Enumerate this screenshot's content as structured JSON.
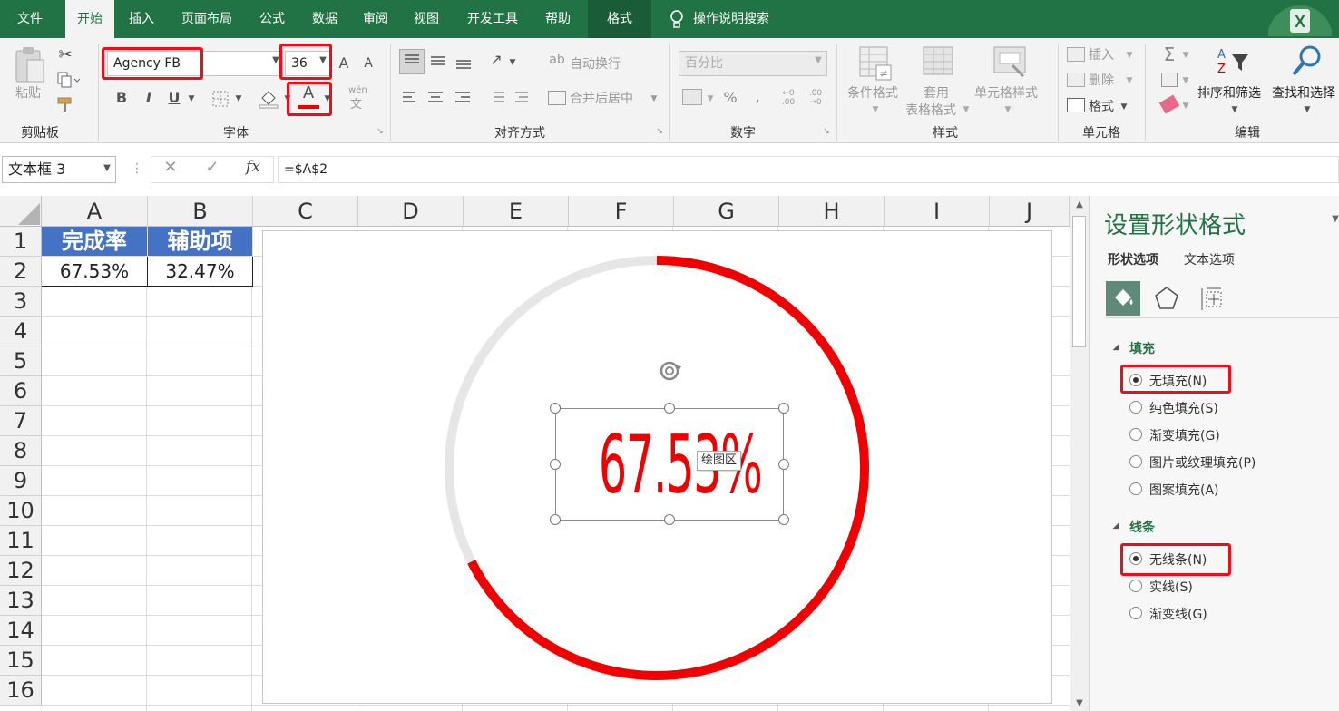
{
  "tabs": [
    "文件",
    "开始",
    "插入",
    "页面布局",
    "公式",
    "数据",
    "审阅",
    "视图",
    "开发工具",
    "帮助",
    "格式"
  ],
  "tell_me": "操作说明搜索",
  "ribbon": {
    "clipboard": {
      "paste": "粘贴",
      "label": "剪贴板"
    },
    "font": {
      "name": "Agency FB",
      "size": "36",
      "bold": "B",
      "italic": "I",
      "underline": "U",
      "grow": "A",
      "shrink": "A",
      "color_a": "A",
      "wen": "wén",
      "wen2": "文",
      "label": "字体"
    },
    "alignment": {
      "wrap": "自动换行",
      "merge": "合并后居中",
      "label": "对齐方式"
    },
    "number": {
      "format": "百分比",
      "percent": "%",
      "comma": ",",
      "label": "数字"
    },
    "styles": {
      "conditional": "条件格式",
      "table1": "套用",
      "table2": "表格格式",
      "cell_styles": "单元格样式",
      "label": "样式"
    },
    "cells": {
      "insert": "插入",
      "delete": "删除",
      "format": "格式",
      "label": "单元格"
    },
    "editing": {
      "sort": "排序和筛选",
      "find": "查找和选择",
      "label": "编辑"
    }
  },
  "formula_bar": {
    "name_box": "文本框 3",
    "cancel": "✕",
    "enter": "✓",
    "fx": "fx",
    "formula": "=$A$2"
  },
  "columns": [
    "A",
    "B",
    "C",
    "D",
    "E",
    "F",
    "G",
    "H",
    "I",
    "J"
  ],
  "rows": [
    "1",
    "2",
    "3",
    "4",
    "5",
    "6",
    "7",
    "8",
    "9",
    "10",
    "11",
    "12",
    "13",
    "14",
    "15",
    "16"
  ],
  "cells": {
    "a1": "完成率",
    "b1": "辅助项",
    "a2": "67.53%",
    "b2": "32.47%"
  },
  "chart": {
    "value_text": "67.53%",
    "tooltip": "绘图区",
    "progress_fraction": 0.6753,
    "progress_color": "#f00000",
    "track_color": "#e6e6e6"
  },
  "pane": {
    "title": "设置形状格式",
    "tab_shape": "形状选项",
    "tab_text": "文本选项",
    "fill_header": "填充",
    "fill_options": [
      "无填充(N)",
      "纯色填充(S)",
      "渐变填充(G)",
      "图片或纹理填充(P)",
      "图案填充(A)"
    ],
    "line_header": "线条",
    "line_options": [
      "无线条(N)",
      "实线(S)",
      "渐变线(G)"
    ]
  },
  "colors": {
    "excel_green": "#217346",
    "highlight_red": "#e8101a",
    "header_blue": "#4472c4"
  }
}
